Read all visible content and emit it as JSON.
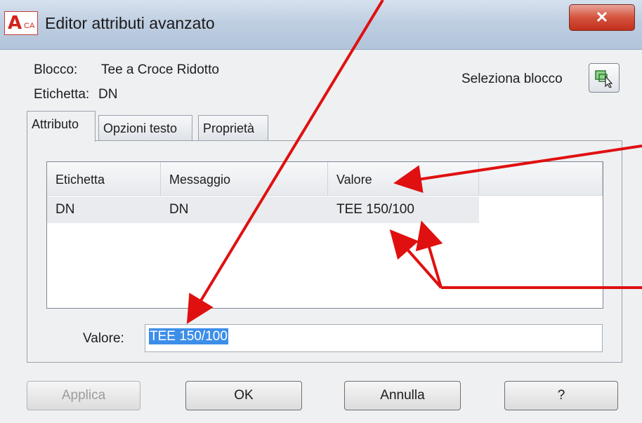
{
  "window": {
    "title": "Editor attributi avanzato",
    "close_glyph": "✕"
  },
  "app_icon": {
    "glyph": "A",
    "sub": "CA"
  },
  "info": {
    "block_label": "Blocco:",
    "block_value": "Tee a Croce Ridotto",
    "tag_label": "Etichetta:",
    "tag_value": "DN",
    "select_label": "Seleziona blocco"
  },
  "tabs": [
    {
      "label": "Attributo",
      "active": true
    },
    {
      "label": "Opzioni testo",
      "active": false
    },
    {
      "label": "Proprietà",
      "active": false
    }
  ],
  "table": {
    "headers": [
      "Etichetta",
      "Messaggio",
      "Valore"
    ],
    "rows": [
      [
        "DN",
        "DN",
        "TEE 150/100"
      ]
    ]
  },
  "value_field": {
    "label": "Valore:",
    "value": "TEE 150/100"
  },
  "buttons": {
    "apply": "Applica",
    "ok": "OK",
    "cancel": "Annulla",
    "help": "?"
  },
  "colors": {
    "annotation_arrow": "#e01010",
    "selection": "#3d8ee8",
    "close_button": "#c9361f"
  }
}
